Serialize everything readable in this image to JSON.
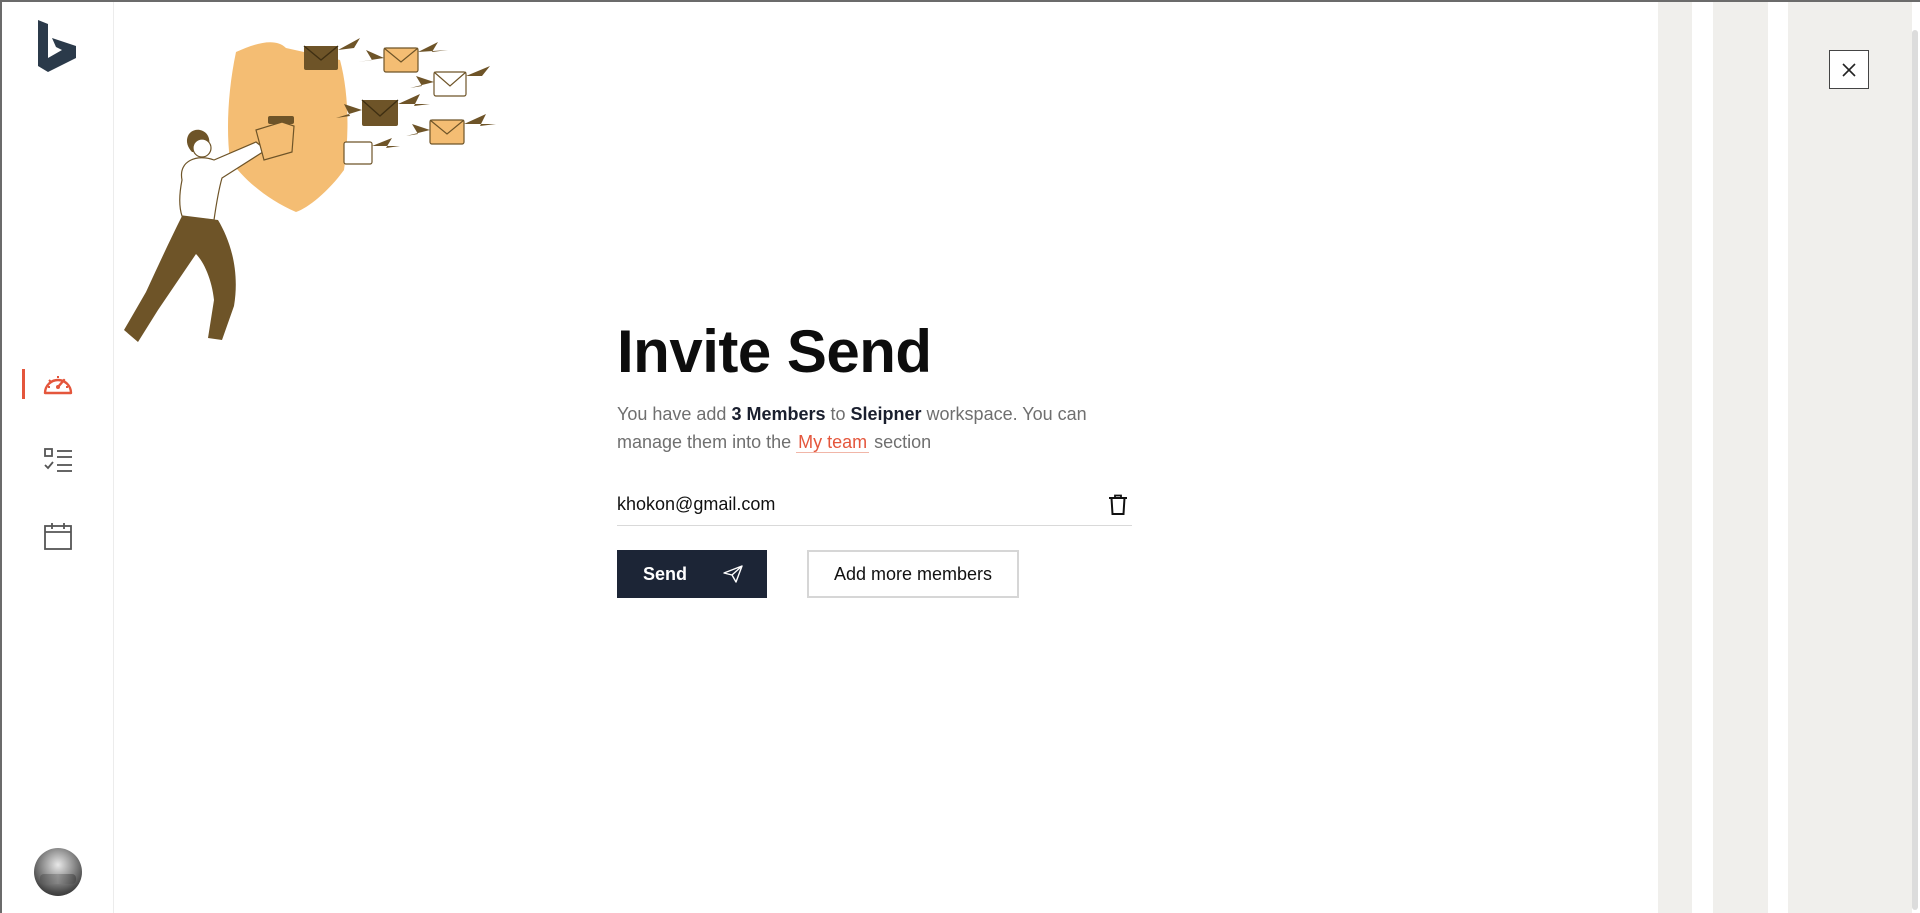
{
  "app": {
    "logo_icon": "bing-logo"
  },
  "sidebar": {
    "items": [
      {
        "icon": "dashboard-gauge-icon",
        "active": true
      },
      {
        "icon": "tasks-checklist-icon",
        "active": false
      },
      {
        "icon": "calendar-icon",
        "active": false
      }
    ],
    "accent_color": "#e4563c"
  },
  "main": {
    "title": "Invite Send",
    "desc_prefix": "You have add ",
    "members_count": "3 Members",
    "desc_to": " to ",
    "workspace": "Sleipner",
    "desc_mid": " workspace. You can manage them into the ",
    "team_link": "My team",
    "desc_suffix": " section",
    "email_value": "khokon@gmail.com",
    "send_label": "Send",
    "add_more_label": "Add more members"
  },
  "colors": {
    "primary": "#1c2536",
    "accent": "#e4563c",
    "illustration": "#f4bd73",
    "illustration_dark": "#6e5428"
  }
}
